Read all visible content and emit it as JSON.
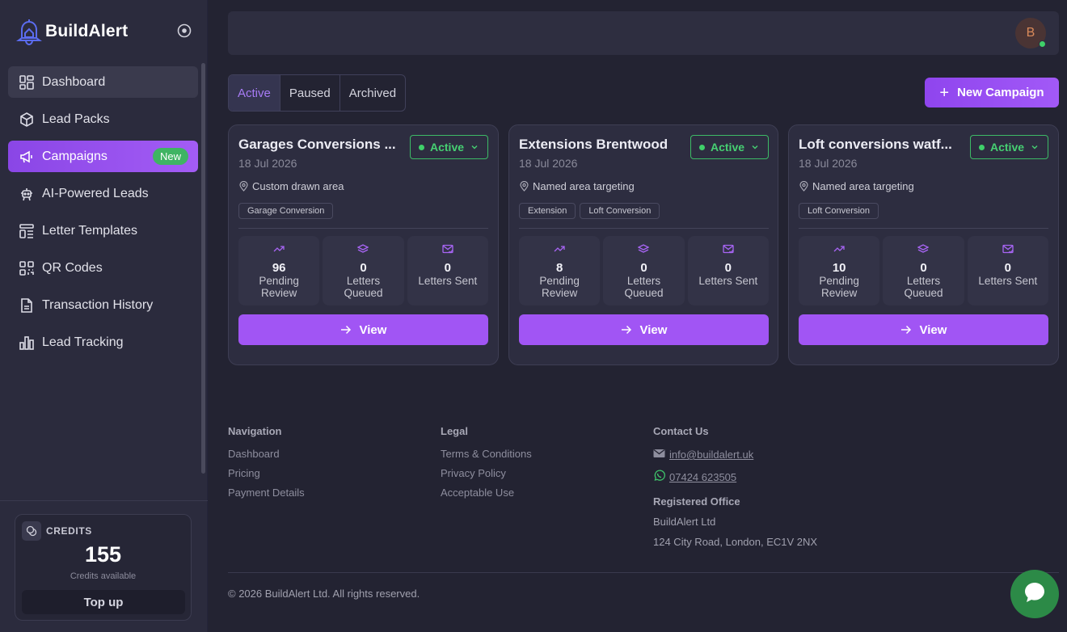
{
  "brand": {
    "name": "BuildAlert"
  },
  "sidebar": {
    "items": [
      {
        "label": "Dashboard",
        "icon": "dashboard-grid-icon"
      },
      {
        "label": "Lead Packs",
        "icon": "package-icon"
      },
      {
        "label": "Campaigns",
        "icon": "megaphone-icon",
        "badge": "New"
      },
      {
        "label": "AI-Powered Leads",
        "icon": "robot-icon"
      },
      {
        "label": "Letter Templates",
        "icon": "template-icon"
      },
      {
        "label": "QR Codes",
        "icon": "qr-code-icon"
      },
      {
        "label": "Transaction History",
        "icon": "receipt-icon"
      },
      {
        "label": "Lead Tracking",
        "icon": "bar-chart-icon"
      }
    ],
    "credits": {
      "label": "CREDITS",
      "value": "155",
      "sub": "Credits available",
      "topup": "Top up"
    }
  },
  "header": {
    "avatar_initial": "B"
  },
  "tabs": [
    "Active",
    "Paused",
    "Archived"
  ],
  "new_campaign_label": "New Campaign",
  "cards": [
    {
      "title": "Garages Conversions ...",
      "date": "18 Jul 2026",
      "status": "Active",
      "area": "Custom drawn area",
      "tags": [
        "Garage Conversion"
      ],
      "stats": [
        {
          "value": "96",
          "label": "Pending Review"
        },
        {
          "value": "0",
          "label": "Letters Queued"
        },
        {
          "value": "0",
          "label": "Letters Sent"
        }
      ],
      "view_label": "View"
    },
    {
      "title": "Extensions Brentwood",
      "date": "18 Jul 2026",
      "status": "Active",
      "area": "Named area targeting",
      "tags": [
        "Extension",
        "Loft Conversion"
      ],
      "stats": [
        {
          "value": "8",
          "label": "Pending Review"
        },
        {
          "value": "0",
          "label": "Letters Queued"
        },
        {
          "value": "0",
          "label": "Letters Sent"
        }
      ],
      "view_label": "View"
    },
    {
      "title": "Loft conversions watf...",
      "date": "18 Jul 2026",
      "status": "Active",
      "area": "Named area targeting",
      "tags": [
        "Loft Conversion"
      ],
      "stats": [
        {
          "value": "10",
          "label": "Pending Review"
        },
        {
          "value": "0",
          "label": "Letters Queued"
        },
        {
          "value": "0",
          "label": "Letters Sent"
        }
      ],
      "view_label": "View"
    }
  ],
  "footer": {
    "navigation": {
      "heading": "Navigation",
      "links": [
        "Dashboard",
        "Pricing",
        "Payment Details"
      ]
    },
    "legal": {
      "heading": "Legal",
      "links": [
        "Terms & Conditions",
        "Privacy Policy",
        "Acceptable Use"
      ]
    },
    "contact": {
      "heading": "Contact Us",
      "email": "info@buildalert.uk",
      "phone": "07424 623505",
      "registered_heading": "Registered Office",
      "company": "BuildAlert Ltd",
      "address": "124 City Road, London, EC1V 2NX"
    },
    "copyright": "© 2026 BuildAlert Ltd. All rights reserved."
  },
  "colors": {
    "accent": "#a155f4",
    "status_green": "#46d072",
    "background": "#232332",
    "sidebar": "#2b2b3d"
  }
}
